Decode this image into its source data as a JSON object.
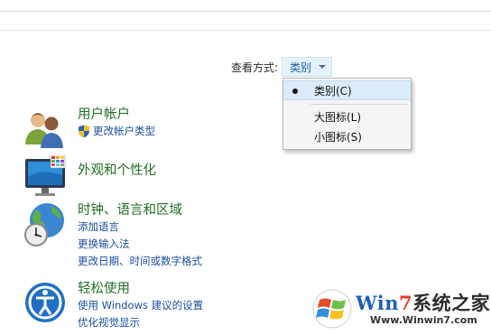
{
  "view_by": {
    "label": "查看方式:",
    "value": "类别"
  },
  "menu": {
    "items": [
      {
        "label": "类别(C)",
        "selected": true
      },
      {
        "label": "大图标(L)",
        "selected": false
      },
      {
        "label": "小图标(S)",
        "selected": false
      }
    ]
  },
  "categories": [
    {
      "icon": "user-accounts-icon",
      "title": "用户帐户",
      "links": [
        {
          "label": "更改帐户类型",
          "icon": "uac-shield-icon"
        }
      ]
    },
    {
      "icon": "appearance-personalization-icon",
      "title": "外观和个性化",
      "links": []
    },
    {
      "icon": "clock-globe-icon",
      "title": "时钟、语言和区域",
      "links": [
        {
          "label": "添加语言"
        },
        {
          "label": "更换输入法"
        },
        {
          "label": "更改日期、时间或数字格式"
        }
      ]
    },
    {
      "icon": "ease-of-access-icon",
      "title": "轻松使用",
      "links": [
        {
          "label": "使用 Windows 建议的设置"
        },
        {
          "label": "优化视觉显示"
        }
      ]
    }
  ],
  "watermark": {
    "brand_win": "Win",
    "brand_7": "7",
    "brand_rest": "系统之家",
    "url": "Www.Winwin7.com"
  },
  "colors": {
    "category_title": "#1f6e23",
    "link": "#1a4fa0",
    "menu_selected_bg": "#dcebfa"
  }
}
